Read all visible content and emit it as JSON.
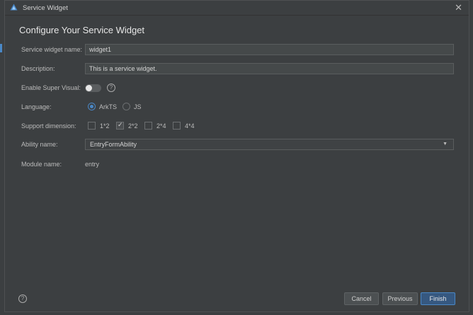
{
  "window": {
    "title": "Service Widget",
    "app_icon": "harmony-logo-icon",
    "close_glyph": "✕"
  },
  "heading": "Configure Your Service Widget",
  "form": {
    "widget_name": {
      "label": "Service widget name:",
      "value": "widget1"
    },
    "description": {
      "label": "Description:",
      "value": "This is a service widget."
    },
    "super_visual": {
      "label": "Enable Super Visual:",
      "enabled": false,
      "help_glyph": "?"
    },
    "language": {
      "label": "Language:",
      "options": [
        {
          "label": "ArkTS",
          "selected": true
        },
        {
          "label": "JS",
          "selected": false
        }
      ]
    },
    "support_dimension": {
      "label": "Support dimension:",
      "options": [
        {
          "label": "1*2",
          "checked": false
        },
        {
          "label": "2*2",
          "checked": true
        },
        {
          "label": "2*4",
          "checked": false
        },
        {
          "label": "4*4",
          "checked": false
        }
      ]
    },
    "ability_name": {
      "label": "Ability name:",
      "value": "EntryFormAbility",
      "arrow": "▼"
    },
    "module_name": {
      "label": "Module name:",
      "value": "entry"
    }
  },
  "footer": {
    "help_glyph": "?",
    "cancel_label": "Cancel",
    "previous_label": "Previous",
    "finish_label": "Finish"
  },
  "colors": {
    "background": "#3c3f41",
    "accent": "#4a88c7",
    "primary_button": "#365880"
  }
}
